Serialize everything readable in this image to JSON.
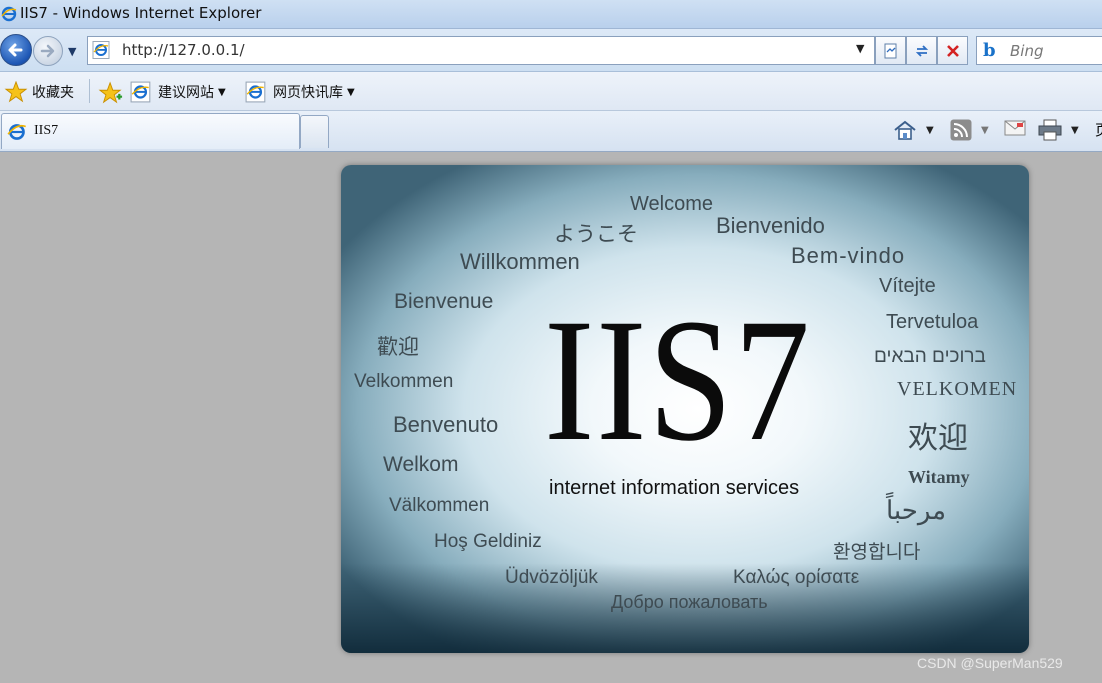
{
  "window": {
    "title": "IIS7 - Windows Internet Explorer"
  },
  "address_bar": {
    "url": "http://127.0.0.1/"
  },
  "search": {
    "logo": "b",
    "placeholder": "Bing"
  },
  "favorites_bar": {
    "favorites_label": "收藏夹",
    "items": [
      {
        "label": "建议网站",
        "icon": "ie-page-icon"
      },
      {
        "label": "网页快讯库",
        "icon": "ie-page-icon"
      }
    ]
  },
  "tabs": [
    {
      "title": "IIS7",
      "icon": "ie-page-icon"
    }
  ],
  "command_bar": {
    "page_label": "页"
  },
  "welcome": {
    "logo": "IIS7",
    "tagline": "internet information services",
    "words": [
      {
        "text": "Welcome"
      },
      {
        "text": "ようこそ"
      },
      {
        "text": "Bienvenido"
      },
      {
        "text": "Willkommen"
      },
      {
        "text": "Bem-vindo"
      },
      {
        "text": "Bienvenue"
      },
      {
        "text": "Vítejte"
      },
      {
        "text": "Tervetuloa"
      },
      {
        "text": "歡迎"
      },
      {
        "text": "ברוכים הבאים"
      },
      {
        "text": "Velkommen"
      },
      {
        "text": "VELKOMEN"
      },
      {
        "text": "Benvenuto"
      },
      {
        "text": "欢迎"
      },
      {
        "text": "Welkom"
      },
      {
        "text": "Witamy"
      },
      {
        "text": "Välkommen"
      },
      {
        "text": "مرحباً"
      },
      {
        "text": "Hoş Geldiniz"
      },
      {
        "text": "환영합니다"
      },
      {
        "text": "Üdvözöljük"
      },
      {
        "text": "Καλώς ορίσατε"
      },
      {
        "text": "Добро пожаловать"
      }
    ]
  },
  "watermark": "CSDN @SuperMan529"
}
